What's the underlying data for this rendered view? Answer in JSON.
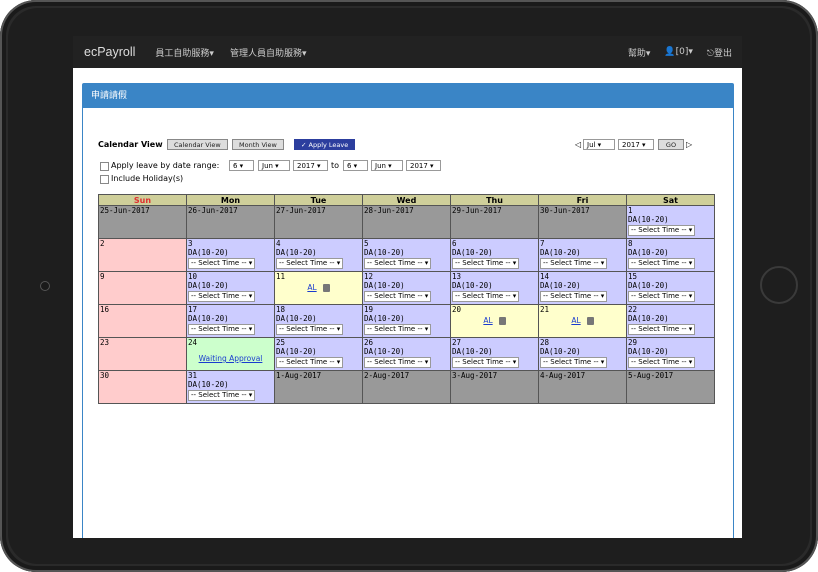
{
  "navbar": {
    "brand": "ecPayroll",
    "menu_employee": "員工自助服務▾",
    "menu_manager": "管理人員自助服務▾",
    "help": "幫助▾",
    "user": "👤[0]▾",
    "logout": "⎋登出"
  },
  "panel": {
    "title": "申請請假"
  },
  "calendar_view": {
    "label": "Calendar View",
    "btn_calendar": "Calendar View",
    "btn_month": "Month View",
    "btn_apply": "✓ Apply Leave"
  },
  "month_nav": {
    "month": "Jul ▾",
    "year": "2017 ▾",
    "go": "GO"
  },
  "range": {
    "label": "Apply leave by date range:",
    "from_day": "6 ▾",
    "from_month": "Jun ▾",
    "from_year": "2017 ▾",
    "to": "to",
    "to_day": "6 ▾",
    "to_month": "Jun ▾",
    "to_year": "2017 ▾",
    "holiday": "Include Holiday(s)"
  },
  "weekdays": [
    "Sun",
    "Mon",
    "Tue",
    "Wed",
    "Thu",
    "Fri",
    "Sat"
  ],
  "shift": "DA(10-20)",
  "select_time": "-- Select Time -- ▾",
  "al": "AL",
  "waiting": "Waiting Approval",
  "rows": [
    [
      {
        "d": "25-Jun-2017",
        "t": "gray"
      },
      {
        "d": "26-Jun-2017",
        "t": "gray"
      },
      {
        "d": "27-Jun-2017",
        "t": "gray"
      },
      {
        "d": "28-Jun-2017",
        "t": "gray"
      },
      {
        "d": "29-Jun-2017",
        "t": "gray"
      },
      {
        "d": "30-Jun-2017",
        "t": "gray"
      },
      {
        "d": "1",
        "t": "wk"
      }
    ],
    [
      {
        "d": "2",
        "t": "sun"
      },
      {
        "d": "3",
        "t": "wk"
      },
      {
        "d": "4",
        "t": "wk"
      },
      {
        "d": "5",
        "t": "wk"
      },
      {
        "d": "6",
        "t": "wk"
      },
      {
        "d": "7",
        "t": "wk"
      },
      {
        "d": "8",
        "t": "wk"
      }
    ],
    [
      {
        "d": "9",
        "t": "sun"
      },
      {
        "d": "10",
        "t": "wk"
      },
      {
        "d": "11",
        "t": "hol"
      },
      {
        "d": "12",
        "t": "wk"
      },
      {
        "d": "13",
        "t": "wk"
      },
      {
        "d": "14",
        "t": "wk"
      },
      {
        "d": "15",
        "t": "wk"
      }
    ],
    [
      {
        "d": "16",
        "t": "sun"
      },
      {
        "d": "17",
        "t": "wk"
      },
      {
        "d": "18",
        "t": "wk"
      },
      {
        "d": "19",
        "t": "wk"
      },
      {
        "d": "20",
        "t": "hol"
      },
      {
        "d": "21",
        "t": "hol"
      },
      {
        "d": "22",
        "t": "wk"
      }
    ],
    [
      {
        "d": "23",
        "t": "sun"
      },
      {
        "d": "24",
        "t": "pend"
      },
      {
        "d": "25",
        "t": "wk"
      },
      {
        "d": "26",
        "t": "wk"
      },
      {
        "d": "27",
        "t": "wk"
      },
      {
        "d": "28",
        "t": "wk"
      },
      {
        "d": "29",
        "t": "wk"
      }
    ],
    [
      {
        "d": "30",
        "t": "sun"
      },
      {
        "d": "31",
        "t": "wk"
      },
      {
        "d": "1-Aug-2017",
        "t": "gray"
      },
      {
        "d": "2-Aug-2017",
        "t": "gray"
      },
      {
        "d": "3-Aug-2017",
        "t": "gray"
      },
      {
        "d": "4-Aug-2017",
        "t": "gray"
      },
      {
        "d": "5-Aug-2017",
        "t": "gray"
      }
    ]
  ],
  "colors": {
    "navbar": "#222222",
    "panel": "#3a85c6",
    "weekday": "#ccccff",
    "sunday": "#ffcccc",
    "leave": "#ffffcc",
    "pending": "#ccffcc",
    "outside": "#999999"
  }
}
